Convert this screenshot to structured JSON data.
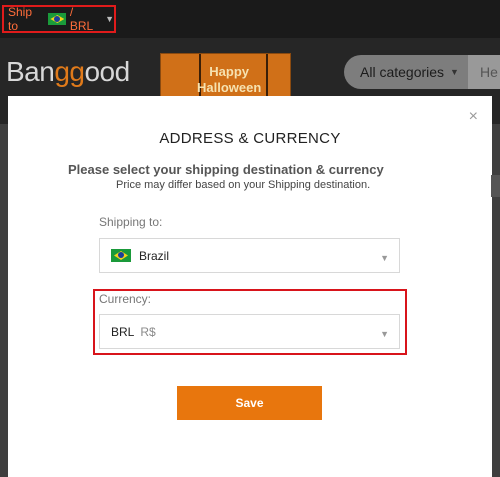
{
  "topbar": {
    "ship_to_label": "Ship to",
    "ship_to_currency": "/ BRL",
    "caret_icon": "caret-down-icon"
  },
  "header": {
    "logo_prefix": "Ban",
    "logo_gg": "gg",
    "logo_suffix": "ood",
    "banner_text_line1": "Happy",
    "banner_text_line2": "Halloween",
    "categories_label": "All categories",
    "search_peek": "He"
  },
  "modal": {
    "title": "ADDRESS & CURRENCY",
    "subtitle": "Please select your shipping destination & currency",
    "note": "Price may differ based on your Shipping destination.",
    "close_symbol": "×",
    "shipping_label": "Shipping to:",
    "country_value": "Brazil",
    "currency_label": "Currency:",
    "currency_code": "BRL",
    "currency_symbol": "R$",
    "save_label": "Save"
  },
  "colors": {
    "accent": "#e8760d",
    "highlight_border": "#d8141b",
    "ship_to_text": "#ff6d3a"
  }
}
